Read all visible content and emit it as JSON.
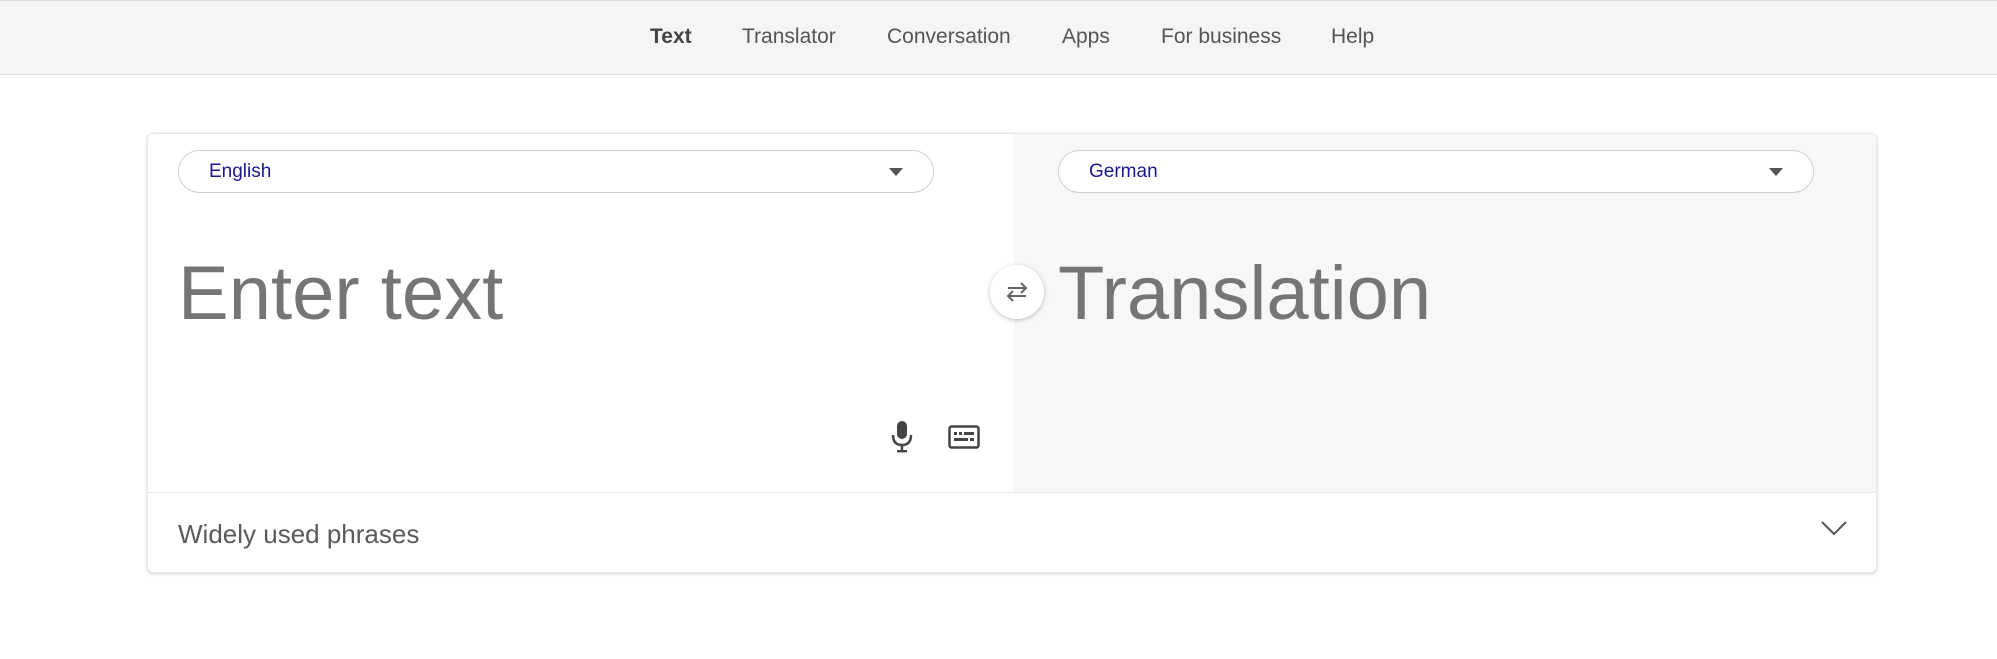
{
  "nav": {
    "items": [
      {
        "label": "Text",
        "active": true
      },
      {
        "label": "Translator",
        "active": false
      },
      {
        "label": "Conversation",
        "active": false
      },
      {
        "label": "Apps",
        "active": false
      },
      {
        "label": "For business",
        "active": false
      },
      {
        "label": "Help",
        "active": false
      }
    ]
  },
  "source": {
    "language": "English",
    "placeholder": "Enter text",
    "icons": [
      "microphone-icon",
      "keyboard-icon"
    ]
  },
  "target": {
    "language": "German",
    "placeholder": "Translation"
  },
  "swap": {
    "icon": "swap-arrows-icon"
  },
  "phrases": {
    "label": "Widely used phrases",
    "icon": "chevron-down-icon"
  },
  "colors": {
    "language_text": "#1a1a8c",
    "placeholder_text": "#757575",
    "nav_background": "#f5f5f5",
    "target_pane_background": "#f7f7f7"
  }
}
